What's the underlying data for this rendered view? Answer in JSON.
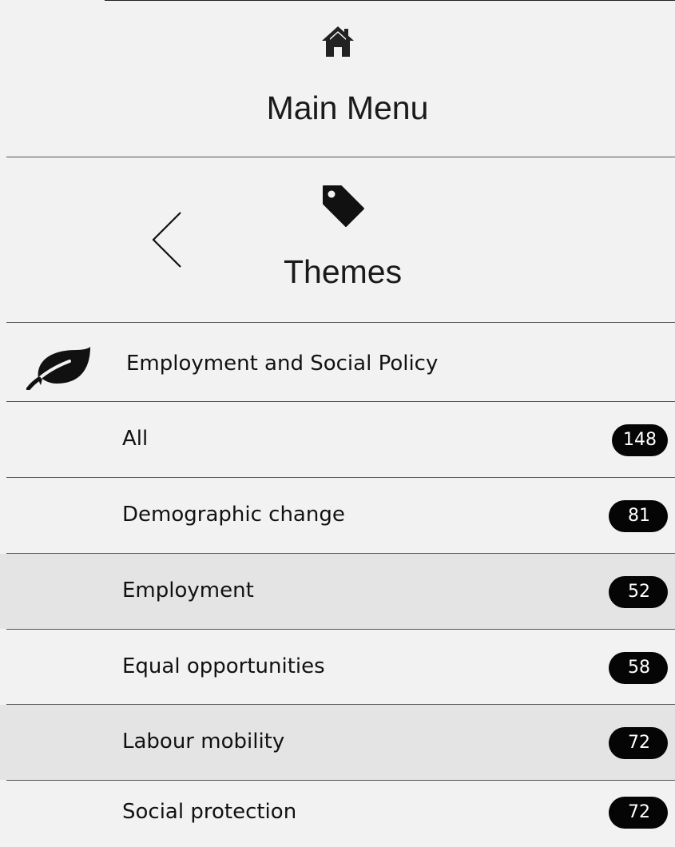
{
  "main_menu": {
    "icon": "home-icon",
    "label": "Main Menu"
  },
  "themes": {
    "back_icon": "chevron-left-icon",
    "icon": "tag-icon",
    "label": "Themes"
  },
  "category": {
    "icon": "leaf-icon",
    "label": "Employment and Social Policy"
  },
  "items": [
    {
      "label": "All",
      "count": "148"
    },
    {
      "label": "Demographic change",
      "count": "81"
    },
    {
      "label": "Employment",
      "count": "52"
    },
    {
      "label": "Equal opportunities",
      "count": "58"
    },
    {
      "label": "Labour mobility",
      "count": "72"
    },
    {
      "label": "Social protection",
      "count": "72"
    }
  ],
  "colors": {
    "background": "#f2f2f2",
    "shaded_row": "#e4e4e4",
    "badge": "#050505",
    "badge_text": "#ffffff"
  }
}
